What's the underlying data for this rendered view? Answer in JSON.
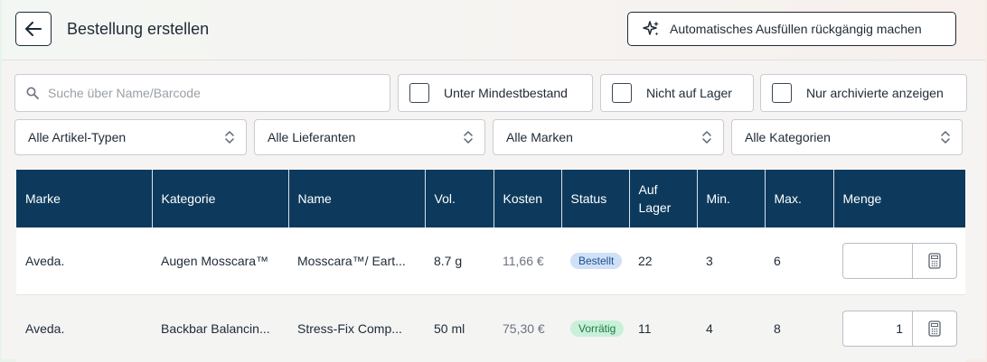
{
  "header": {
    "title": "Bestellung erstellen",
    "autofill_undo_label": "Automatisches Ausfüllen rückgängig machen"
  },
  "filters": {
    "search_placeholder": "Suche über Name/Barcode",
    "checkboxes": [
      "Unter Mindestbestand",
      "Nicht auf Lager",
      "Nur archivierte anzeigen"
    ],
    "selects": [
      "Alle Artikel-Typen",
      "Alle Lieferanten",
      "Alle Marken",
      "Alle Kategorien"
    ]
  },
  "table": {
    "columns": [
      "Marke",
      "Kategorie",
      "Name",
      "Vol.",
      "Kosten",
      "Status",
      "Auf Lager",
      "Min.",
      "Max.",
      "Menge"
    ],
    "rows": [
      {
        "marke": "Aveda.",
        "kategorie": "Augen Mosscara™",
        "name": "Mosscara™/ Eart...",
        "vol": "8.7 g",
        "kosten": "11,66 €",
        "status": "Bestellt",
        "auf_lager": "22",
        "min": "3",
        "max": "6",
        "menge": ""
      },
      {
        "marke": "Aveda.",
        "kategorie": "Backbar Balancin...",
        "name": "Stress-Fix Comp...",
        "vol": "50 ml",
        "kosten": "75,30 €",
        "status": "Vorrätig",
        "auf_lager": "11",
        "min": "4",
        "max": "8",
        "menge": "1"
      }
    ]
  },
  "colors": {
    "header_bg": "#0d3a5c",
    "status_bestellt_bg": "#cfe0f7",
    "status_bestellt_fg": "#1d4f8f",
    "status_vorratig_bg": "#c9f0d9",
    "status_vorratig_fg": "#1b7a45"
  },
  "icons": [
    "arrow-left-icon",
    "sparkles-icon",
    "search-icon",
    "chevron-updown-icon",
    "calculator-icon"
  ]
}
